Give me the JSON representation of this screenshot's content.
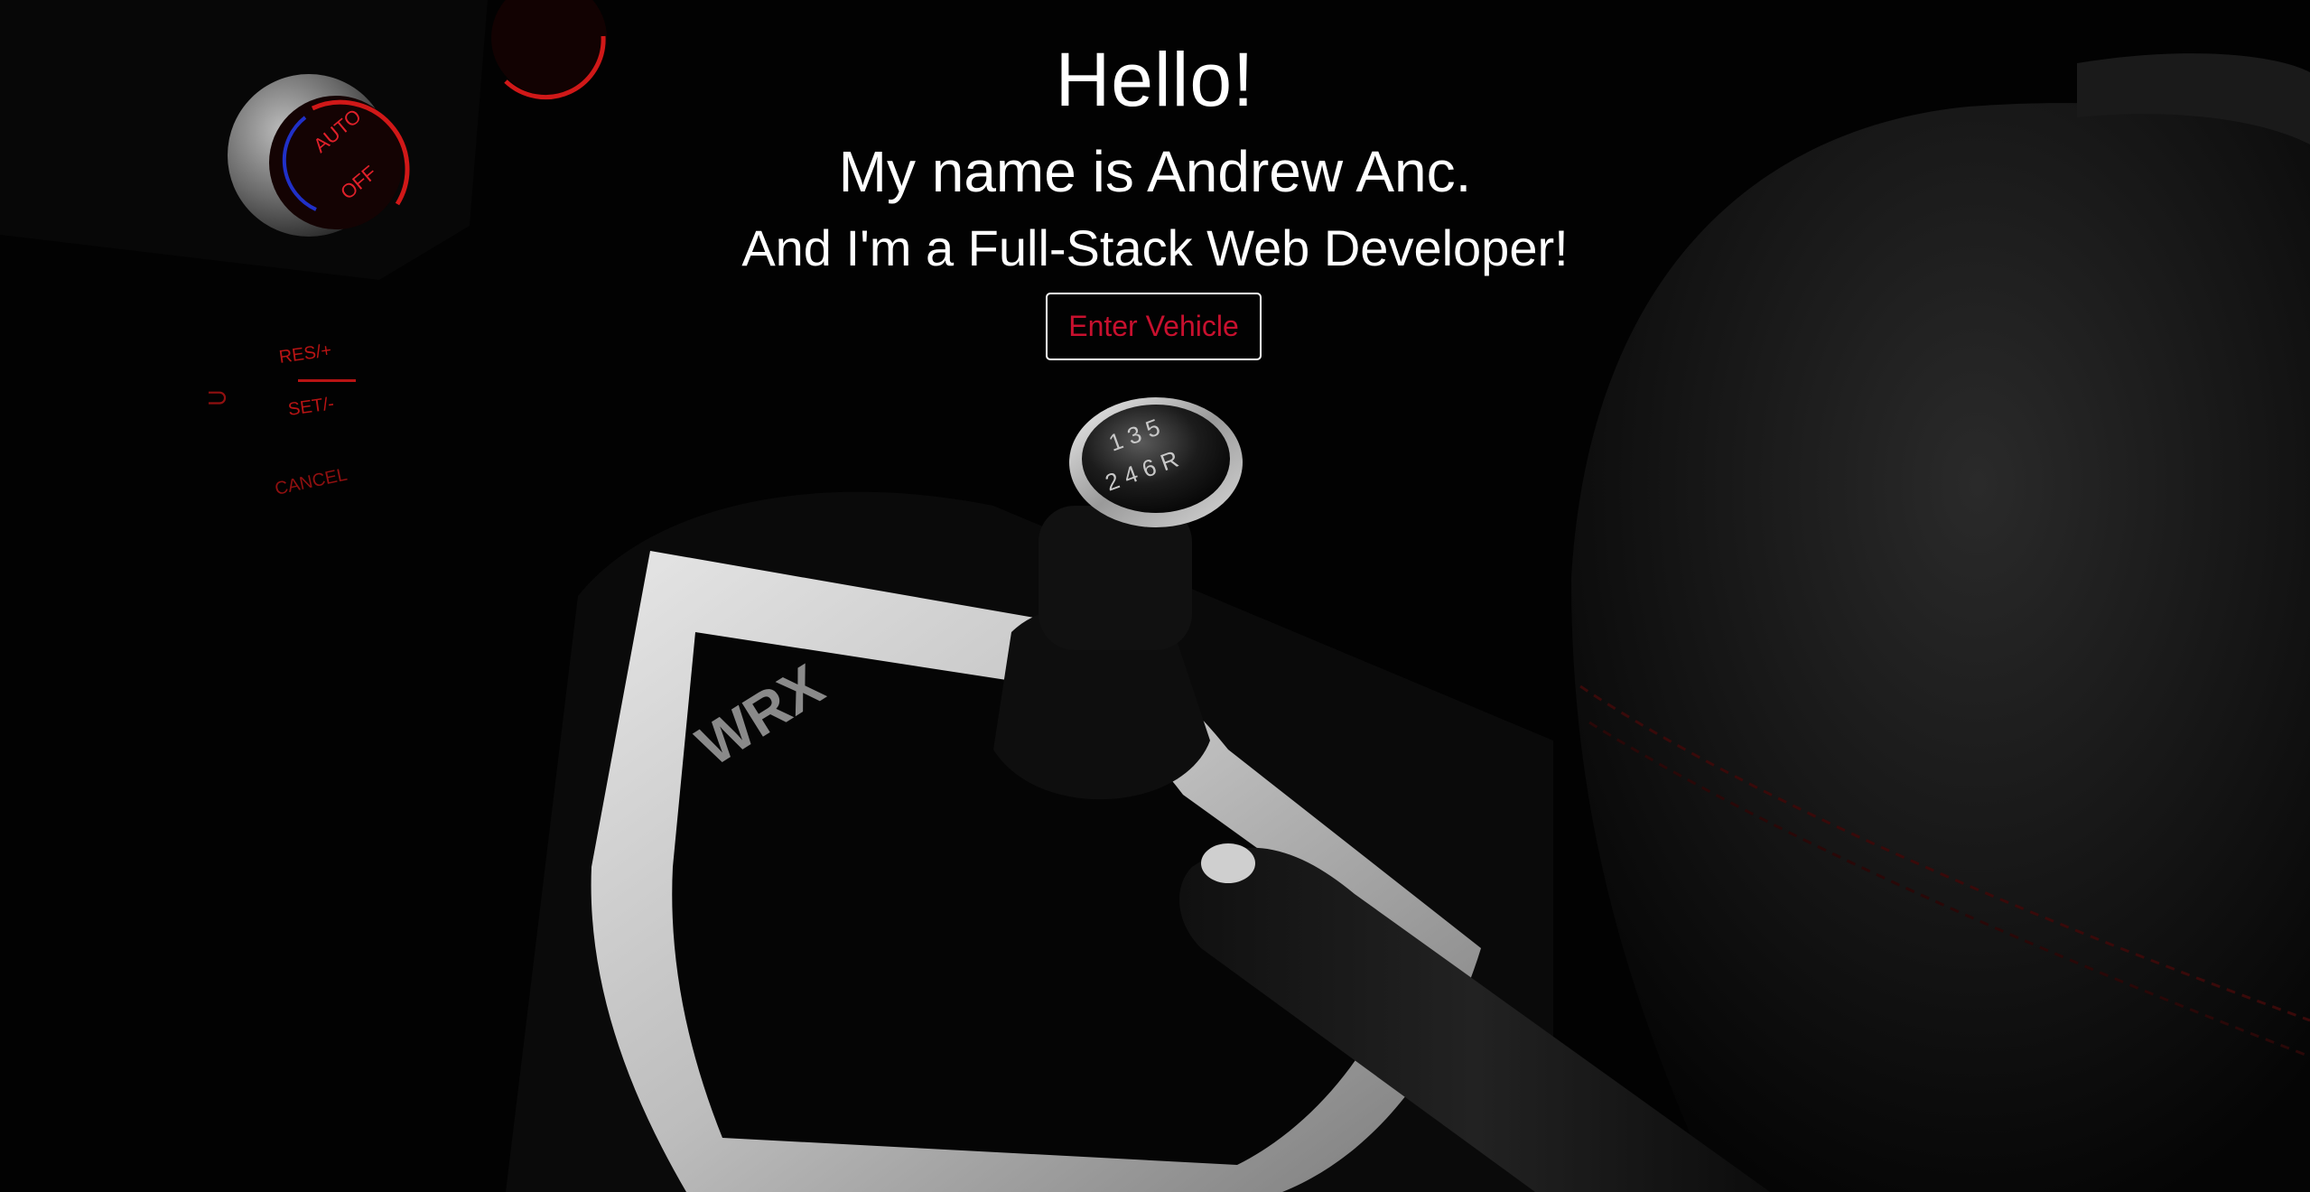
{
  "hero": {
    "greeting": "Hello!",
    "name_line": "My name is Andrew Anc.",
    "role_line": "And I'm a Full-Stack Web Developer!",
    "cta_label": "Enter Vehicle"
  },
  "background": {
    "scene": "car-interior-photo",
    "knob_labels": [
      "1 3 5",
      "2 4 6 R"
    ],
    "console_badge": "WRX",
    "dial_labels": [
      "AUTO",
      "OFF"
    ],
    "control_labels": [
      "RES/+",
      "SET/-",
      "CANCEL"
    ]
  },
  "colors": {
    "page_background": "#020202",
    "text": "#ffffff",
    "accent_red": "#c8102e",
    "button_border": "#ffffff"
  }
}
